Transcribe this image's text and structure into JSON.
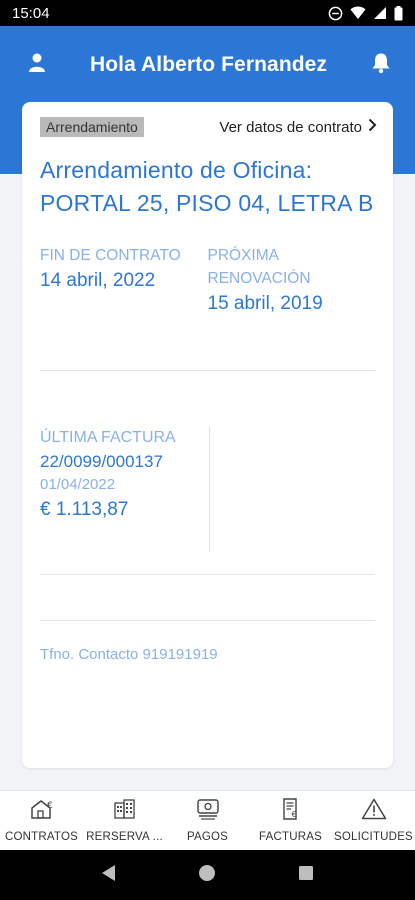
{
  "status_bar": {
    "time": "15:04"
  },
  "header": {
    "greeting": "Hola Alberto Fernandez"
  },
  "card": {
    "type_badge": "Arrendamiento",
    "contract_link": "Ver datos de contrato",
    "title": "Arrendamiento de Oficina: PORTAL 25, PISO 04, LETRA B",
    "end_label": "FIN DE CONTRATO",
    "end_date": "14 abril, 2022",
    "renewal_label": "PRÓXIMA RENOVACIÓN",
    "renewal_date": "15 abril, 2019",
    "invoice_label": "ÚLTIMA FACTURA",
    "invoice_number": "22/0099/000137",
    "invoice_date": "01/04/2022",
    "invoice_amount": "€ 1.113,87",
    "contact": "Tfno. Contacto 919191919"
  },
  "bottom_nav": {
    "items": [
      {
        "label": "CONTRATOS",
        "icon": "house-euro-icon"
      },
      {
        "label": "RERSERVA ...",
        "icon": "building-icon"
      },
      {
        "label": "PAGOS",
        "icon": "payment-icon"
      },
      {
        "label": "FACTURAS",
        "icon": "invoice-icon"
      },
      {
        "label": "SOLICITUDES",
        "icon": "warning-icon"
      }
    ]
  },
  "colors": {
    "primary": "#2c77d6",
    "light_blue": "#8ab0ea"
  }
}
